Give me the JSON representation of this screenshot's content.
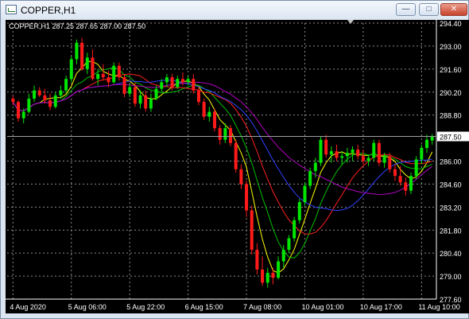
{
  "window": {
    "title": "COPPER,H1",
    "minimize_glyph": "—",
    "maximize_glyph": "□",
    "close_glyph": "✕"
  },
  "chart_data": {
    "type": "candlestick",
    "symbol_info": "COPPER,H1  287.25 287.65 287.00 287.50",
    "current_price_label": "287.50",
    "current_price": 287.5,
    "ylim": [
      277.6,
      294.4
    ],
    "y_ticks": [
      "294.40",
      "293.00",
      "291.60",
      "290.20",
      "288.80",
      "287.50",
      "286.00",
      "284.60",
      "283.20",
      "281.80",
      "280.40",
      "279.00",
      "277.60"
    ],
    "y_tick_values": [
      294.4,
      293.0,
      291.6,
      290.2,
      288.8,
      287.5,
      286.0,
      284.6,
      283.2,
      281.8,
      280.4,
      279.0,
      277.6
    ],
    "x_ticks": [
      "4 Aug 2020",
      "5 Aug 06:00",
      "5 Aug 22:00",
      "6 Aug 15:00",
      "7 Aug 08:00",
      "10 Aug 01:00",
      "10 Aug 17:00",
      "11 Aug 10:00"
    ],
    "x_tick_bars": [
      0,
      11,
      22,
      33,
      44,
      55,
      66,
      77
    ],
    "grid": true,
    "colors": {
      "background": "#000000",
      "bull": "#00e600",
      "bear": "#ff1a1a",
      "grid": "#8c8c8c",
      "axis_text": "#ffffff",
      "ma_fast": "#ffff00",
      "ma_mid": "#00c000",
      "ma_slow": "#ff2020",
      "ma_slower": "#3040ff",
      "ma_slowest": "#b000c0"
    },
    "candles": [
      [
        289.8,
        290.0,
        289.4,
        289.6
      ],
      [
        289.6,
        289.7,
        288.4,
        288.6
      ],
      [
        288.6,
        289.2,
        288.3,
        289.0
      ],
      [
        289.0,
        290.1,
        288.9,
        289.8
      ],
      [
        289.8,
        290.6,
        289.6,
        290.3
      ],
      [
        290.3,
        290.5,
        289.9,
        290.0
      ],
      [
        290.0,
        290.4,
        289.5,
        289.7
      ],
      [
        289.7,
        290.1,
        289.1,
        289.3
      ],
      [
        289.3,
        290.2,
        289.2,
        290.0
      ],
      [
        290.0,
        290.6,
        289.8,
        290.3
      ],
      [
        290.3,
        291.2,
        290.1,
        291.0
      ],
      [
        291.0,
        292.4,
        290.8,
        292.2
      ],
      [
        292.2,
        293.4,
        291.9,
        293.2
      ],
      [
        293.2,
        293.5,
        291.5,
        291.6
      ],
      [
        291.6,
        292.6,
        291.3,
        292.3
      ],
      [
        292.3,
        292.8,
        290.9,
        291.0
      ],
      [
        291.0,
        291.6,
        290.6,
        291.3
      ],
      [
        291.3,
        291.9,
        290.9,
        291.1
      ],
      [
        291.1,
        291.5,
        290.5,
        290.8
      ],
      [
        290.8,
        292.0,
        290.7,
        291.8
      ],
      [
        291.8,
        292.0,
        290.9,
        291.1
      ],
      [
        291.1,
        291.3,
        289.9,
        290.1
      ],
      [
        290.1,
        290.7,
        289.9,
        290.5
      ],
      [
        290.5,
        290.8,
        289.3,
        289.5
      ],
      [
        289.5,
        290.3,
        289.2,
        290.0
      ],
      [
        290.0,
        290.3,
        289.0,
        289.2
      ],
      [
        289.2,
        290.1,
        289.0,
        289.8
      ],
      [
        289.8,
        290.6,
        289.7,
        290.4
      ],
      [
        290.4,
        291.0,
        290.2,
        290.8
      ],
      [
        290.8,
        291.3,
        290.5,
        291.1
      ],
      [
        291.1,
        291.3,
        290.3,
        290.5
      ],
      [
        290.5,
        291.2,
        290.4,
        291.0
      ],
      [
        291.0,
        291.4,
        290.6,
        290.8
      ],
      [
        290.8,
        291.2,
        290.6,
        291.0
      ],
      [
        291.0,
        291.3,
        290.1,
        290.3
      ],
      [
        290.3,
        290.5,
        289.4,
        289.6
      ],
      [
        289.6,
        289.8,
        288.5,
        288.7
      ],
      [
        288.7,
        289.3,
        288.4,
        289.0
      ],
      [
        289.0,
        289.2,
        287.8,
        288.0
      ],
      [
        288.0,
        288.2,
        287.0,
        287.3
      ],
      [
        287.3,
        288.3,
        287.1,
        288.0
      ],
      [
        288.0,
        288.2,
        286.9,
        287.1
      ],
      [
        287.1,
        287.3,
        285.3,
        285.5
      ],
      [
        285.5,
        285.8,
        284.3,
        284.6
      ],
      [
        284.6,
        284.8,
        282.6,
        283.0
      ],
      [
        283.0,
        283.3,
        280.3,
        280.6
      ],
      [
        280.6,
        281.0,
        279.1,
        279.4
      ],
      [
        279.4,
        280.2,
        278.4,
        278.6
      ],
      [
        278.6,
        279.5,
        278.3,
        279.2
      ],
      [
        279.2,
        279.5,
        278.5,
        278.9
      ],
      [
        278.9,
        280.2,
        278.8,
        279.9
      ],
      [
        279.9,
        280.9,
        279.5,
        280.6
      ],
      [
        280.6,
        281.5,
        280.4,
        281.3
      ],
      [
        281.3,
        282.6,
        281.1,
        282.4
      ],
      [
        282.4,
        283.7,
        282.2,
        283.5
      ],
      [
        283.5,
        284.7,
        283.3,
        284.5
      ],
      [
        284.5,
        285.6,
        284.3,
        285.4
      ],
      [
        285.4,
        286.2,
        285.0,
        285.9
      ],
      [
        285.9,
        287.5,
        285.7,
        287.3
      ],
      [
        287.3,
        287.6,
        286.2,
        286.4
      ],
      [
        286.4,
        286.9,
        285.9,
        286.6
      ],
      [
        286.6,
        287.0,
        286.0,
        286.2
      ],
      [
        286.2,
        286.6,
        285.8,
        286.3
      ],
      [
        286.3,
        286.8,
        285.9,
        286.5
      ],
      [
        286.5,
        286.9,
        286.0,
        286.7
      ],
      [
        286.7,
        287.0,
        286.1,
        286.3
      ],
      [
        286.3,
        286.7,
        285.8,
        286.0
      ],
      [
        286.0,
        286.4,
        285.7,
        286.2
      ],
      [
        286.2,
        287.3,
        286.0,
        287.1
      ],
      [
        287.1,
        287.3,
        285.7,
        285.9
      ],
      [
        285.9,
        286.5,
        285.6,
        286.3
      ],
      [
        286.3,
        286.5,
        285.3,
        285.5
      ],
      [
        285.5,
        285.8,
        284.8,
        285.1
      ],
      [
        285.1,
        285.7,
        284.5,
        284.7
      ],
      [
        284.7,
        285.0,
        283.9,
        284.2
      ],
      [
        284.2,
        285.3,
        284.0,
        285.1
      ],
      [
        285.1,
        286.3,
        284.9,
        286.1
      ],
      [
        286.1,
        287.0,
        285.8,
        286.8
      ],
      [
        286.8,
        287.6,
        286.5,
        287.3
      ],
      [
        287.25,
        287.65,
        287.0,
        287.5
      ]
    ]
  }
}
